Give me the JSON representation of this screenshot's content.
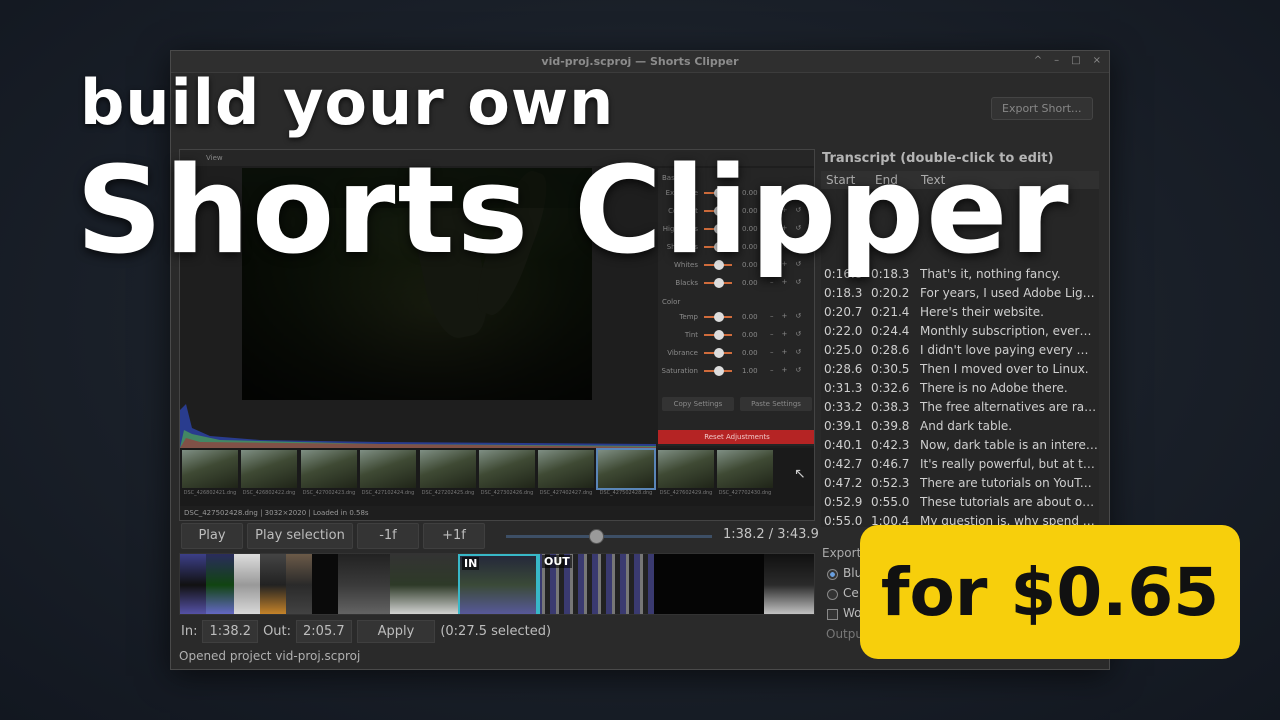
{
  "window": {
    "title": "vid-proj.scproj — Shorts Clipper",
    "controls": [
      "^",
      "–",
      "□",
      "×"
    ],
    "export_button": "Export Short..."
  },
  "preview": {
    "menu": [
      "View"
    ],
    "status": "DSC_427502428.dng | 3032×2020 | Loaded in 0.58s",
    "panel": {
      "basic_label": "Basic",
      "color_label": "Color",
      "rows": [
        {
          "label": "Exposure",
          "value": "0.00"
        },
        {
          "label": "Contrast",
          "value": "0.00"
        },
        {
          "label": "Highlights",
          "value": "0.00"
        },
        {
          "label": "Shadows",
          "value": "0.00"
        },
        {
          "label": "Whites",
          "value": "0.00"
        },
        {
          "label": "Blacks",
          "value": "0.00"
        }
      ],
      "color_rows": [
        {
          "label": "Temp",
          "value": "0.00"
        },
        {
          "label": "Tint",
          "value": "0.00"
        },
        {
          "label": "Vibrance",
          "value": "0.00"
        },
        {
          "label": "Saturation",
          "value": "1.00"
        }
      ],
      "copy_settings": "Copy Settings",
      "paste_settings": "Paste Settings",
      "reset": "Reset Adjustments"
    },
    "thumbnails": [
      "DSC_426802421.dng",
      "DSC_426802422.dng",
      "DSC_427002423.dng",
      "DSC_427102424.dng",
      "DSC_427202425.dng",
      "DSC_427302426.dng",
      "DSC_427402427.dng",
      "DSC_427502428.dng",
      "DSC_427602429.dng",
      "DSC_427702430.dng"
    ]
  },
  "transport": {
    "play": "Play",
    "play_selection": "Play selection",
    "back_frame": "-1f",
    "fwd_frame": "+1f",
    "timecode": "1:38.2 / 3:43.9",
    "seek_fraction": 0.438
  },
  "timeline": {
    "in_tag": "IN",
    "out_tag": "OUT"
  },
  "inout": {
    "in_label": "In:",
    "in_value": "1:38.2",
    "out_label": "Out:",
    "out_value": "2:05.7",
    "apply": "Apply",
    "selected": "(0:27.5 selected)"
  },
  "status": "Opened project vid-proj.scproj",
  "transcript": {
    "title": "Transcript  (double-click to edit)",
    "headers": [
      "Start",
      "End",
      "Text"
    ],
    "rows": [
      {
        "start": "0:16.8",
        "end": "0:18.3",
        "text": "That's it, nothing fancy."
      },
      {
        "start": "0:18.3",
        "end": "0:20.2",
        "text": "For years, I used Adobe Lightroom."
      },
      {
        "start": "0:20.7",
        "end": "0:21.4",
        "text": "Here's their website."
      },
      {
        "start": "0:22.0",
        "end": "0:24.4",
        "text": "Monthly subscription, every month."
      },
      {
        "start": "0:25.0",
        "end": "0:28.6",
        "text": "I didn't love paying every month."
      },
      {
        "start": "0:28.6",
        "end": "0:30.5",
        "text": "Then I moved over to Linux."
      },
      {
        "start": "0:31.3",
        "end": "0:32.6",
        "text": "There is no Adobe there."
      },
      {
        "start": "0:33.2",
        "end": "0:38.3",
        "text": "The free alternatives are rawtherapee"
      },
      {
        "start": "0:39.1",
        "end": "0:39.8",
        "text": "And dark table."
      },
      {
        "start": "0:40.1",
        "end": "0:42.3",
        "text": "Now, dark table is an interesting one."
      },
      {
        "start": "0:42.7",
        "end": "0:46.7",
        "text": "It's really powerful, but at the same time"
      },
      {
        "start": "0:47.2",
        "end": "0:52.3",
        "text": "There are tutorials on YouTube"
      },
      {
        "start": "0:52.9",
        "end": "0:55.0",
        "text": "These tutorials are about one hour long."
      },
      {
        "start": "0:55.0",
        "end": "1:00.4",
        "text": "My question is, why spend one hour"
      }
    ]
  },
  "export": {
    "label": "Export",
    "options": [
      "Blu",
      "Ce",
      "Wo"
    ],
    "output_label": "Outpu"
  },
  "overlay": {
    "headline_small": "build your own",
    "headline_big": "Shorts Clipper",
    "price": "for $0.65",
    "price_color": "#f7cf0c"
  }
}
